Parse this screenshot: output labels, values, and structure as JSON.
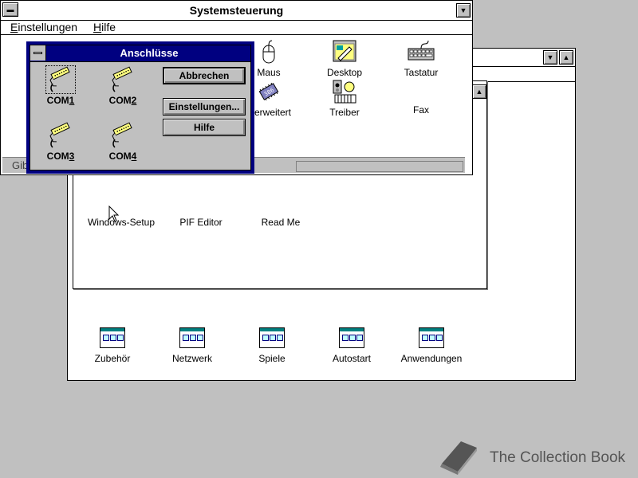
{
  "progman": {
    "group_icons_top": [
      {
        "label": "Windows-Setup"
      },
      {
        "label": "PIF Editor"
      },
      {
        "label": "Read Me"
      }
    ],
    "groups": [
      {
        "label": "Zubehör"
      },
      {
        "label": "Netzwerk"
      },
      {
        "label": "Spiele"
      },
      {
        "label": "Autostart"
      },
      {
        "label": "Anwendungen"
      }
    ]
  },
  "syswin": {
    "title": "Systemsteuerung",
    "menu": [
      {
        "label": "Einstellungen",
        "accel": "E"
      },
      {
        "label": "Hilfe",
        "accel": "H"
      }
    ],
    "icons": [
      {
        "label": "Maus",
        "icon": "mouse-icon"
      },
      {
        "label": "Desktop",
        "icon": "desktop-icon"
      },
      {
        "label": "Tastatur",
        "icon": "keyboard-icon"
      },
      {
        "label": "6 erweitert",
        "icon": "chip-icon"
      },
      {
        "label": "Treiber",
        "icon": "drivers-icon"
      },
      {
        "label": "Fax",
        "icon": "fax-icon"
      }
    ],
    "status": "Gib"
  },
  "dialog": {
    "title": "Anschlüsse",
    "ports": [
      {
        "pre": "COM",
        "num": "1",
        "selected": true
      },
      {
        "pre": "COM",
        "num": "2",
        "selected": false
      },
      {
        "pre": "COM",
        "num": "3",
        "selected": false
      },
      {
        "pre": "COM",
        "num": "4",
        "selected": false
      }
    ],
    "buttons": {
      "cancel": "Abbrechen",
      "settings": "Einstellungen...",
      "help": "Hilfe"
    }
  },
  "watermark": {
    "text": "The Collection Book"
  }
}
